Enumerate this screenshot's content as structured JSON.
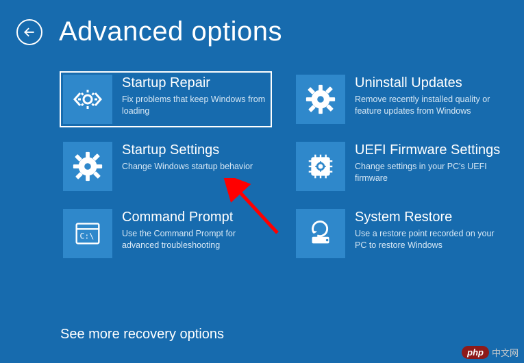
{
  "header": {
    "title": "Advanced options"
  },
  "tiles": [
    {
      "title": "Startup Repair",
      "desc": "Fix problems that keep Windows from loading",
      "icon": "code-gear",
      "selected": true
    },
    {
      "title": "Uninstall Updates",
      "desc": "Remove recently installed quality or feature updates from Windows",
      "icon": "gear",
      "selected": false
    },
    {
      "title": "Startup Settings",
      "desc": "Change Windows startup behavior",
      "icon": "gear",
      "selected": false
    },
    {
      "title": "UEFI Firmware Settings",
      "desc": "Change settings in your PC's UEFI firmware",
      "icon": "chip-gear",
      "selected": false
    },
    {
      "title": "Command Prompt",
      "desc": "Use the Command Prompt for advanced troubleshooting",
      "icon": "cmd",
      "selected": false
    },
    {
      "title": "System Restore",
      "desc": "Use a restore point recorded on your PC to restore Windows",
      "icon": "restore",
      "selected": false
    }
  ],
  "footer": {
    "more": "See more recovery options"
  },
  "watermark": {
    "brand": "php",
    "text": "中文网"
  }
}
